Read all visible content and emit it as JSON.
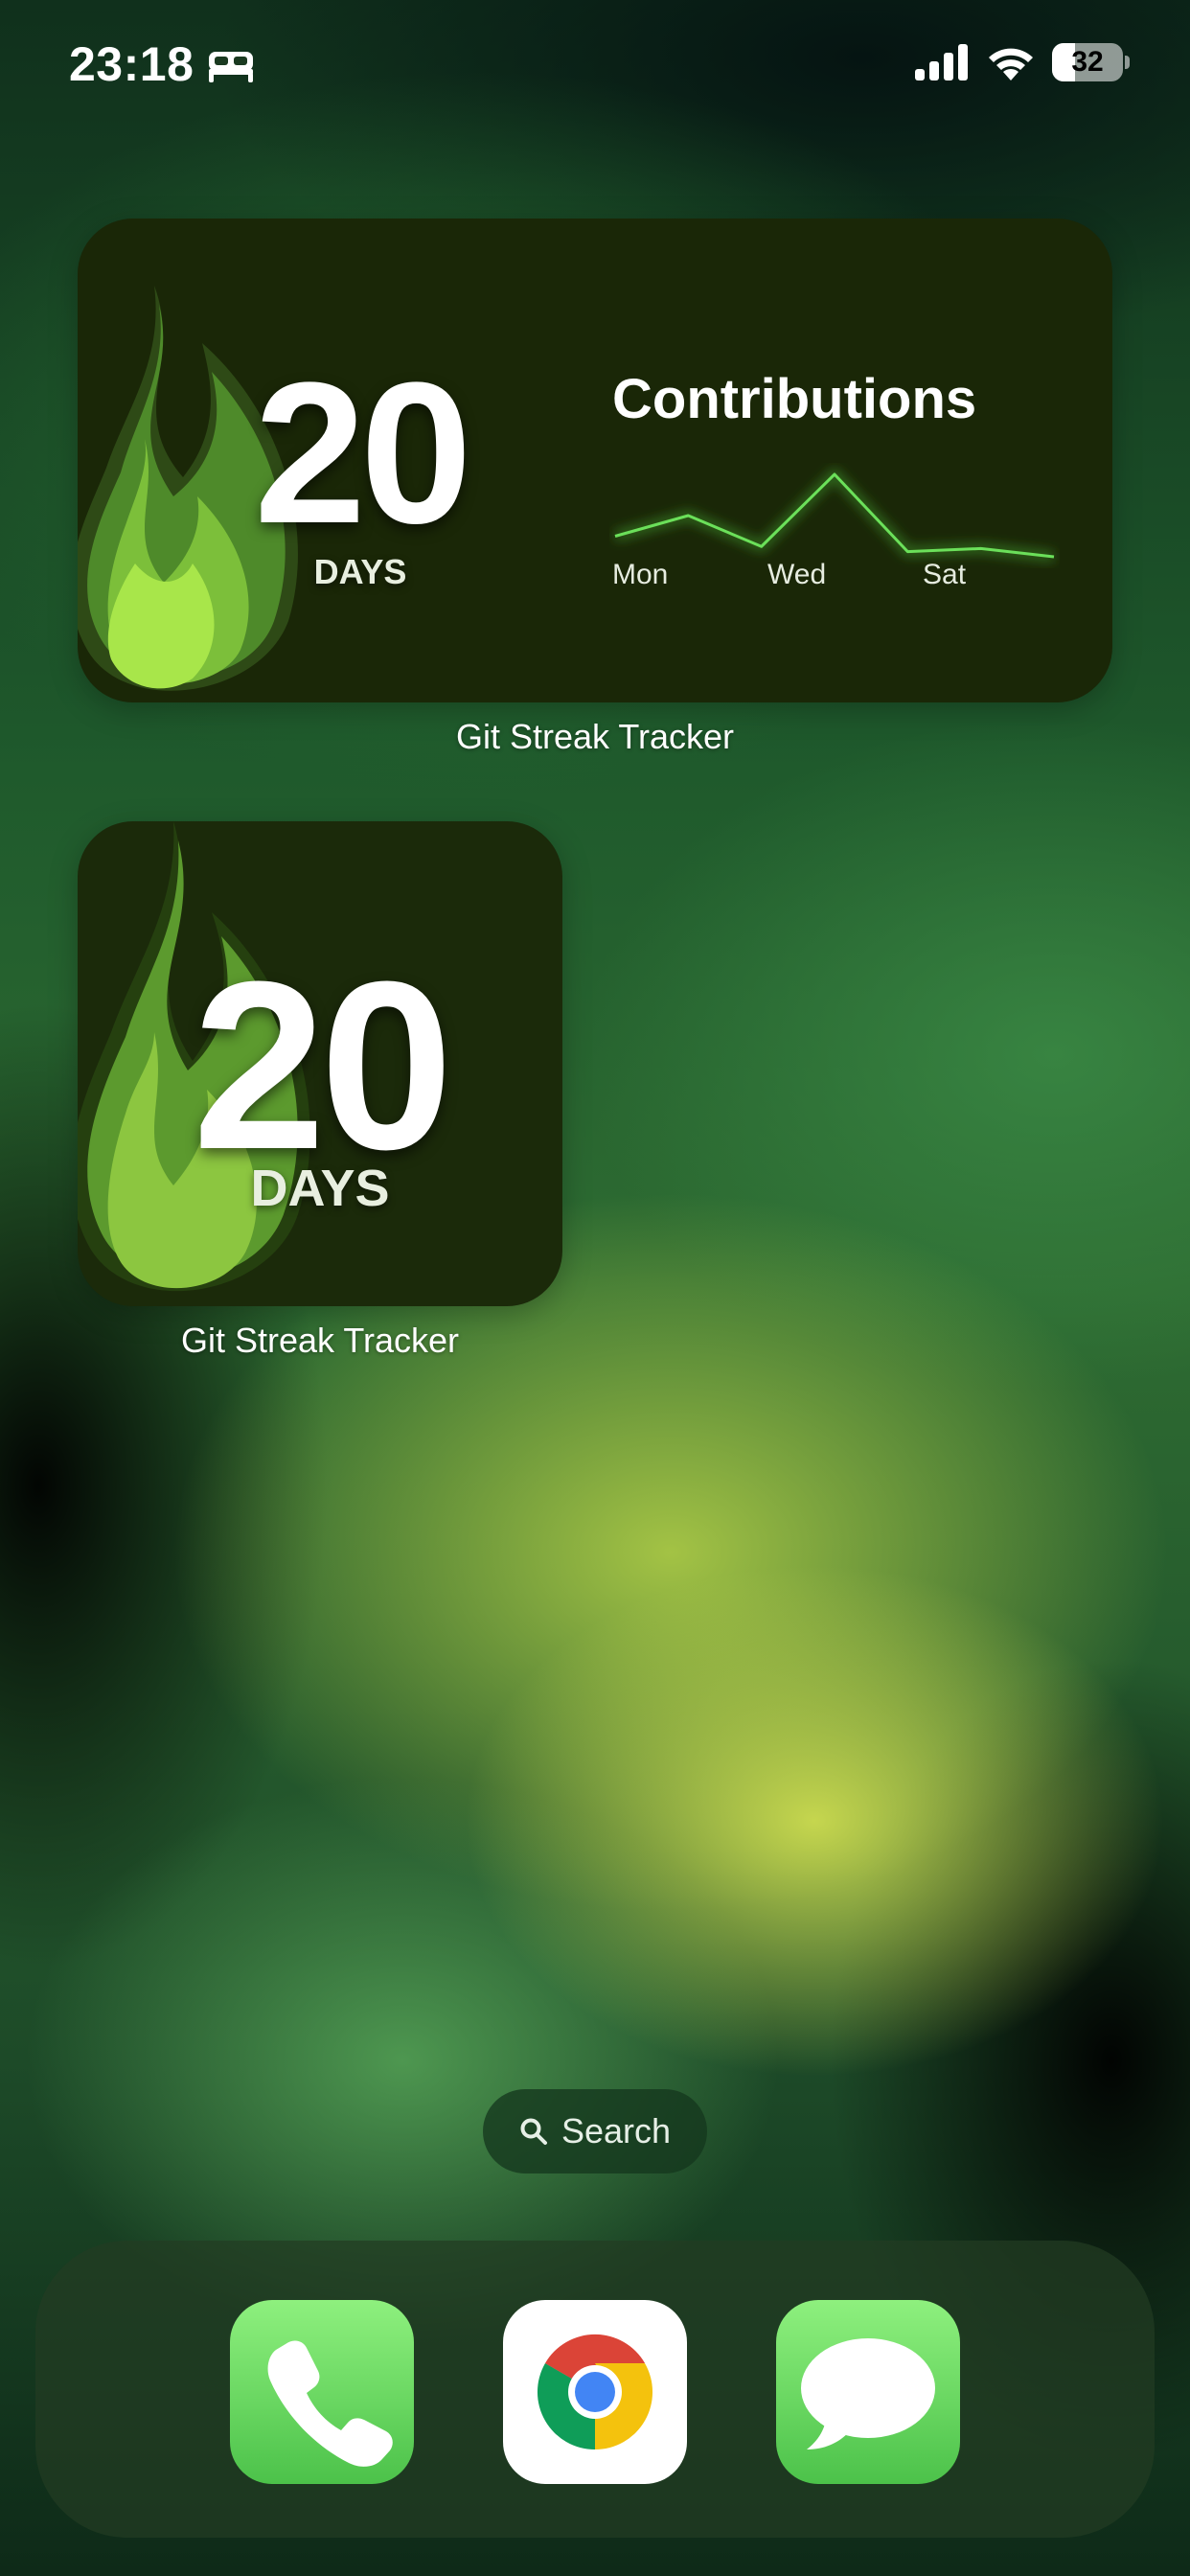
{
  "status_bar": {
    "time": "23:18",
    "focus_icon": "bed-icon",
    "battery_level": "32",
    "battery_fraction": 0.32
  },
  "widget_medium": {
    "streak_value": "20",
    "streak_unit": "DAYS",
    "chart_title": "Contributions",
    "chart_labels": [
      "Mon",
      "Wed",
      "Sat"
    ],
    "caption": "Git Streak Tracker"
  },
  "widget_small": {
    "streak_value": "20",
    "streak_unit": "DAYS",
    "caption": "Git Streak Tracker"
  },
  "chart_data": {
    "type": "line",
    "x": [
      "Mon",
      "Tue",
      "Wed",
      "Thu",
      "Fri",
      "Sat",
      "Sun"
    ],
    "series": [
      {
        "values": [
          2,
          4,
          1,
          8,
          0.5,
          0.8,
          0
        ]
      }
    ],
    "x_tick_labels": [
      "Mon",
      "Wed",
      "Sat"
    ],
    "color": "#6be05a"
  },
  "search": {
    "label": "Search",
    "icon": "magnifier-icon"
  },
  "dock": {
    "apps": [
      {
        "name": "Phone",
        "icon": "phone-icon"
      },
      {
        "name": "Chrome",
        "icon": "chrome-icon"
      },
      {
        "name": "Messages",
        "icon": "messages-icon"
      }
    ]
  }
}
